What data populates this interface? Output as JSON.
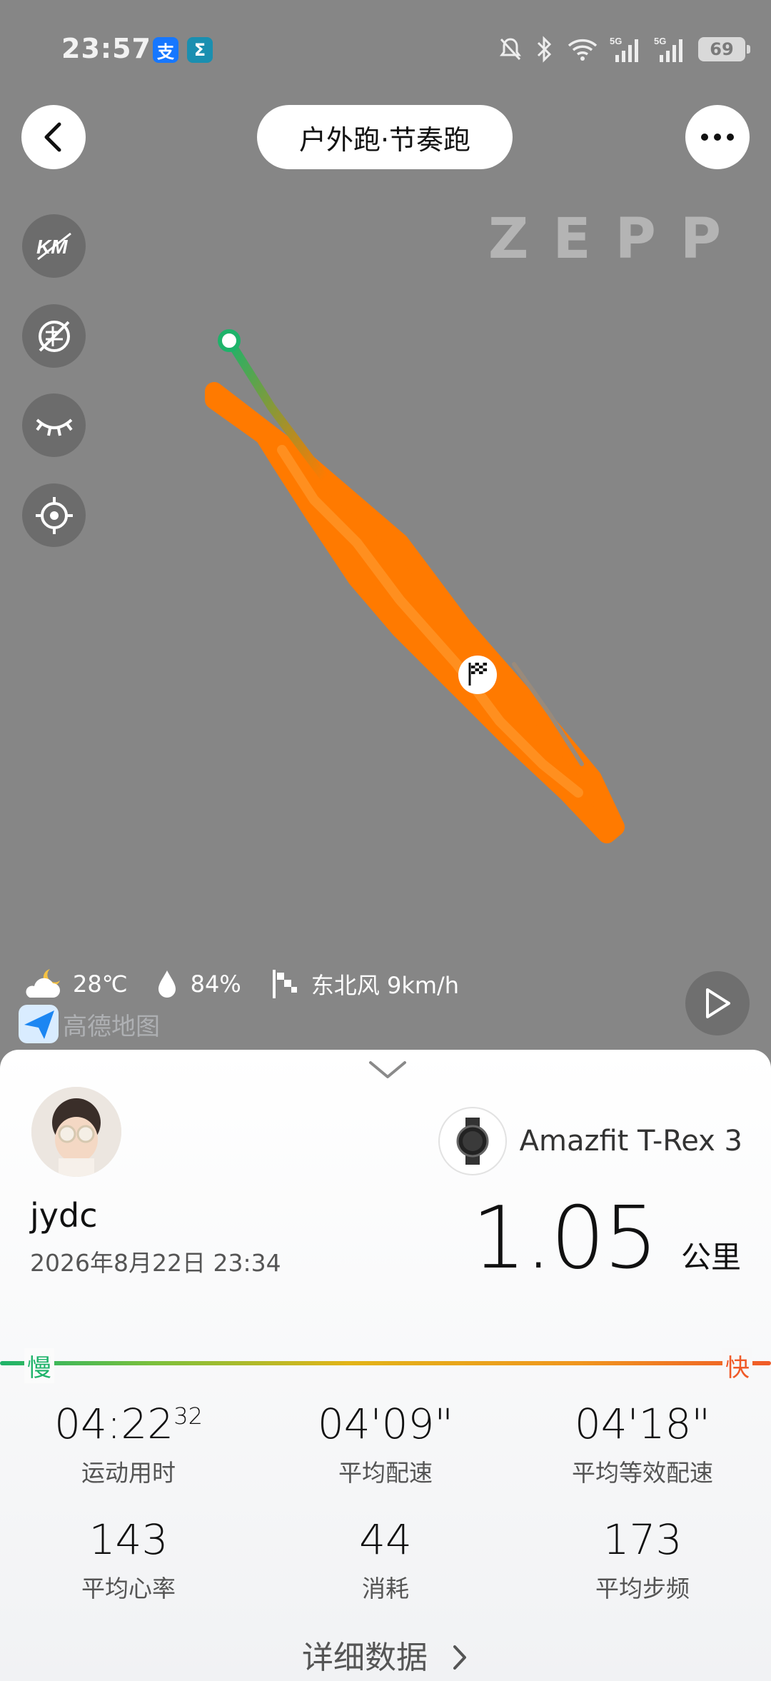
{
  "status_bar": {
    "time": "23:57",
    "app_badges": [
      {
        "label": "支",
        "color": "#1677ff"
      },
      {
        "label": "Σ",
        "color": "#1a8fb0"
      }
    ],
    "battery": "69"
  },
  "header": {
    "title": "户外跑·节奏跑",
    "brand": "ZEPP"
  },
  "map_tools": [
    {
      "icon": "distance-marker-icon"
    },
    {
      "icon": "satellite-toggle-icon"
    },
    {
      "icon": "eye-closed-icon"
    },
    {
      "icon": "locate-icon"
    }
  ],
  "weather": {
    "temperature": "28℃",
    "humidity": "84%",
    "wind": "东北风 9km/h"
  },
  "map_provider": "高德地图",
  "panel": {
    "username": "jydc",
    "datetime": "2026年8月22日 23:34",
    "device_name": "Amazfit T-Rex 3",
    "distance_value": "1.05",
    "distance_unit": "公里",
    "pace_slow": "慢",
    "pace_fast": "快",
    "stats": [
      {
        "value": "04:22",
        "sup": "32",
        "label": "运动用时"
      },
      {
        "value": "04'09\"",
        "sup": "",
        "label": "平均配速"
      },
      {
        "value": "04'18\"",
        "sup": "",
        "label": "平均等效配速"
      },
      {
        "value": "143",
        "sup": "",
        "label": "平均心率"
      },
      {
        "value": "44",
        "sup": "",
        "label": "消耗"
      },
      {
        "value": "173",
        "sup": "",
        "label": "平均步频"
      }
    ],
    "details_label": "详细数据"
  },
  "colors": {
    "map_bg": "#868686",
    "route": "#ff7a00",
    "route_start": "#1eb36a",
    "pace_slow": "#1eb36a",
    "pace_fast": "#f05a28"
  }
}
